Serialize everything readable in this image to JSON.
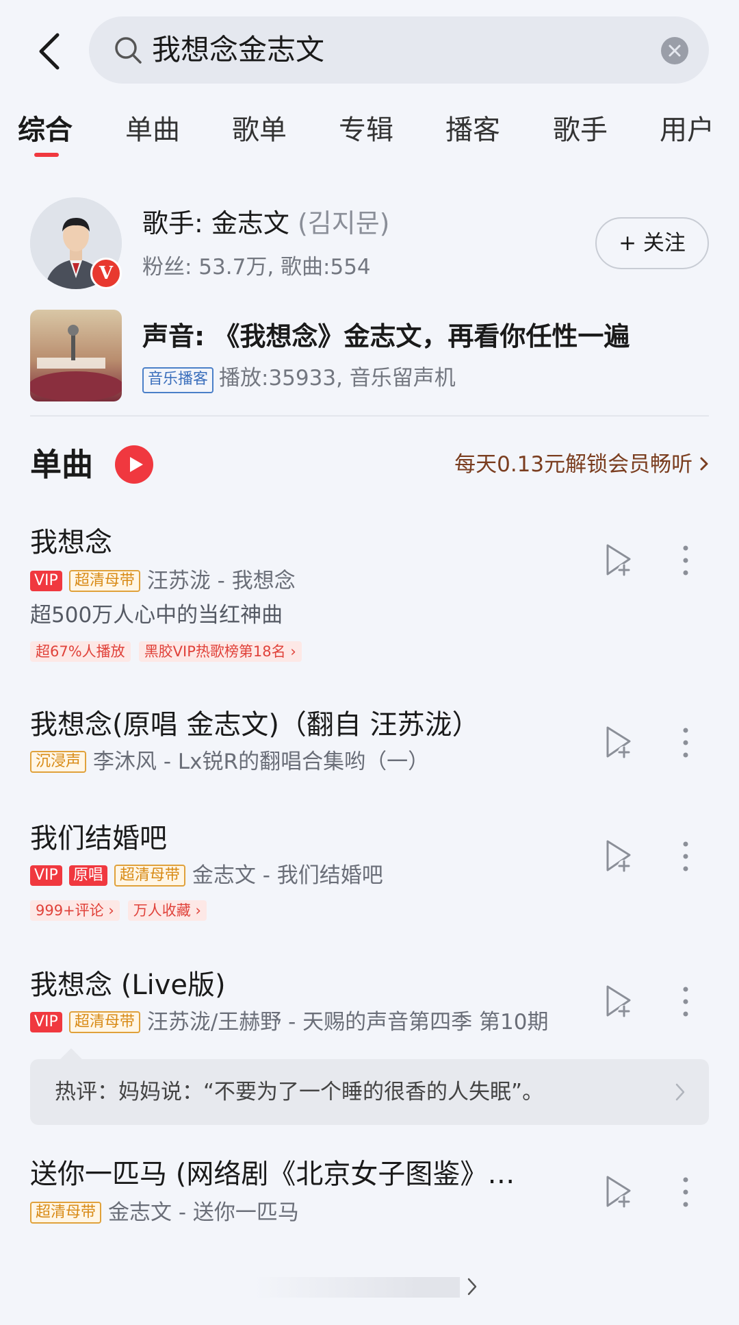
{
  "search": {
    "query": "我想念金志文"
  },
  "tabs": [
    {
      "label": "综合",
      "active": true
    },
    {
      "label": "单曲"
    },
    {
      "label": "歌单"
    },
    {
      "label": "专辑"
    },
    {
      "label": "播客"
    },
    {
      "label": "歌手"
    },
    {
      "label": "用户"
    }
  ],
  "artist": {
    "title": "歌手: 金志文 ",
    "korean_name": "(김지문)",
    "stats": "粉丝: 53.7万, 歌曲:554",
    "follow_label": "+ 关注",
    "verified_badge": "V"
  },
  "podcast": {
    "title": "声音: 《我想念》金志文，再看你任性一遍",
    "tag": "音乐播客",
    "stats": "播放:35933, 音乐留声机"
  },
  "songs_section": {
    "title": "单曲",
    "promo": "每天0.13元解锁会员畅听"
  },
  "songs": [
    {
      "title": "我想念",
      "badges": [
        "VIP",
        "超清母带"
      ],
      "artist": "汪苏泷 - 我想念",
      "desc": "超500万人心中的当红神曲",
      "tags": [
        "超67%人播放",
        "黑胶VIP热歌榜第18名"
      ]
    },
    {
      "title": "我想念(原唱 金志文)（翻自 汪苏泷）",
      "badges": [
        "沉浸声"
      ],
      "artist": "李沐风 - Lx锐R的翻唱合集哟（一）"
    },
    {
      "title": "我们结婚吧",
      "badges": [
        "VIP",
        "原唱",
        "超清母带"
      ],
      "artist": "金志文 - 我们结婚吧",
      "tags": [
        "999+评论",
        "万人收藏"
      ]
    },
    {
      "title": "我想念 (Live版)",
      "badges": [
        "VIP",
        "超清母带"
      ],
      "artist": "汪苏泷/王赫野 - 天赐的声音第四季 第10期"
    },
    {
      "title": "送你一匹马 (网络剧《北京女子图鉴》…",
      "badges": [
        "超清母带"
      ],
      "artist": "金志文 - 送你一匹马"
    }
  ],
  "hot_comment": "热评：妈妈说：“不要为了一个睡的很香的人失眠”。",
  "colors": {
    "accent": "#f0383f",
    "hq_badge": "#d88a15",
    "promo": "#7a3d1f"
  }
}
